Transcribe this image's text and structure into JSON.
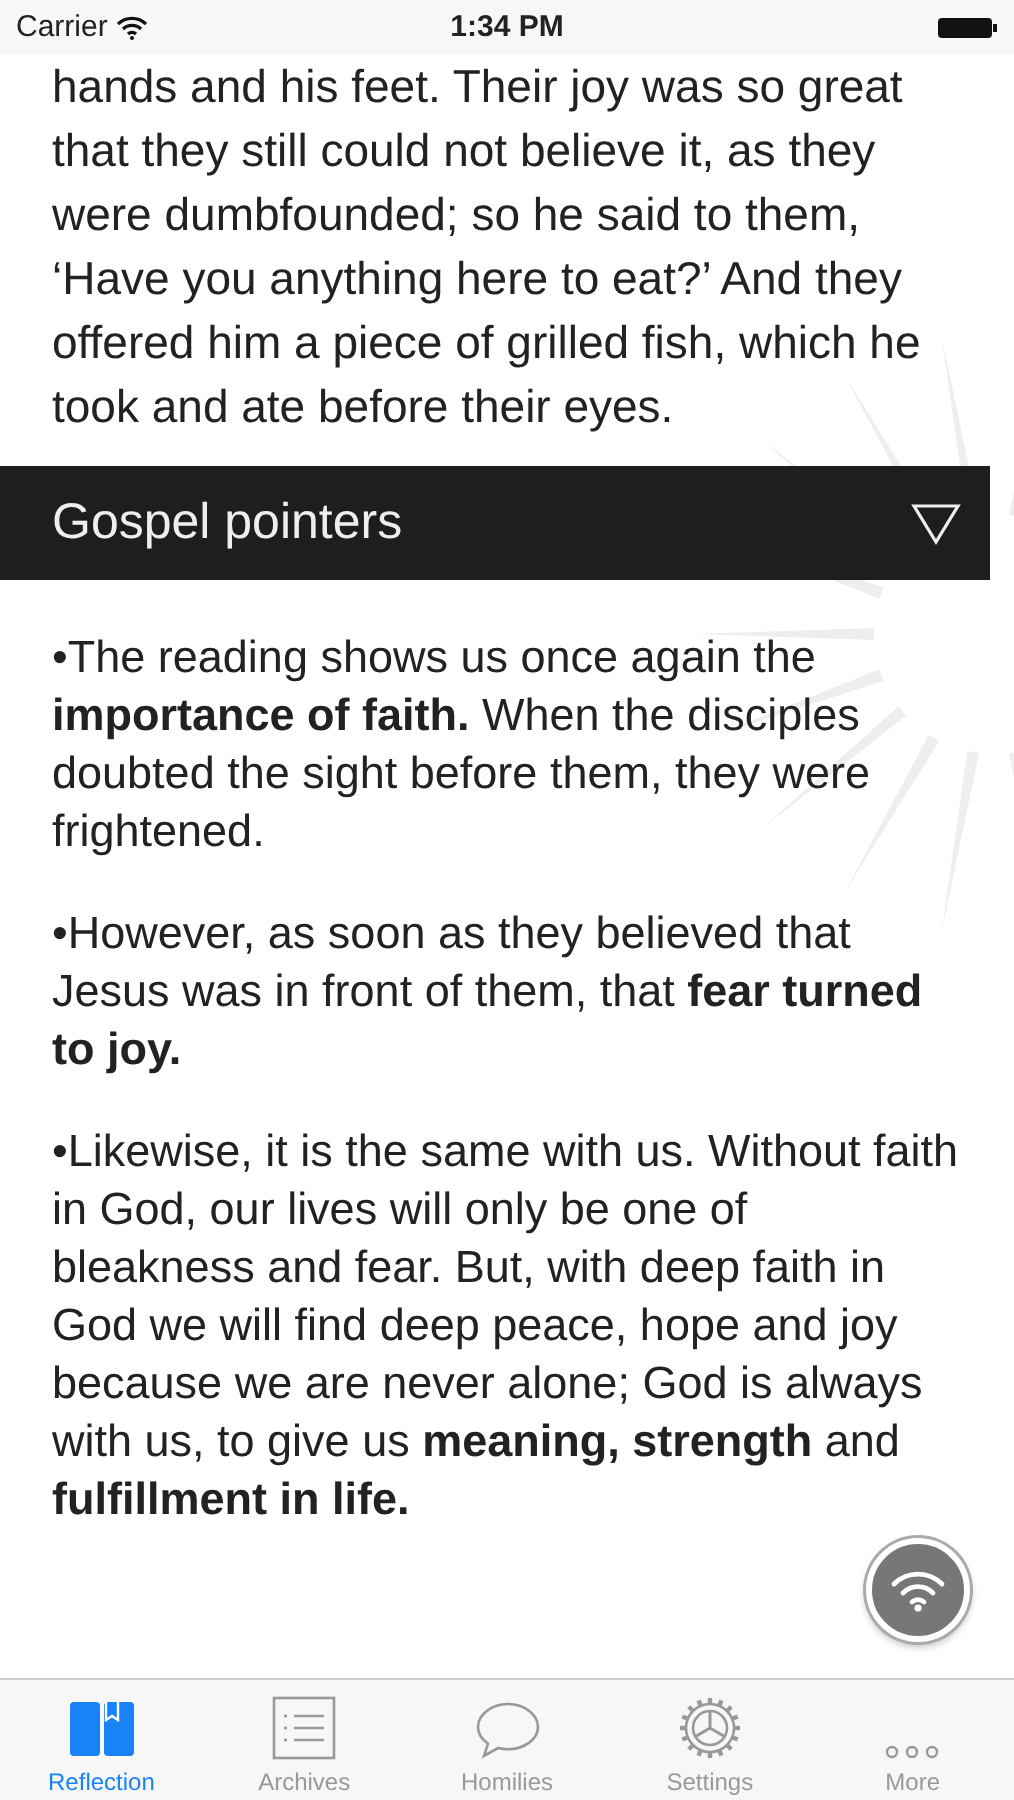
{
  "status_bar": {
    "carrier": "Carrier",
    "time": "1:34 PM"
  },
  "reading": {
    "lines": [
      "hands and his feet. Their joy was so great",
      "that they still could not believe it, as they",
      "were dumbfounded; so he said to them,",
      "‘Have you anything here to eat?’ And they",
      "offered him a piece of grilled fish, which he",
      "took and ate before their eyes."
    ]
  },
  "section": {
    "title": "Gospel pointers",
    "expanded": true
  },
  "pointers": [
    "•The reading shows us once again the **importance of faith.** When the disciples doubted the sight before them, they were frightened.",
    "•However, as soon as they believed that Jesus was in front of them, that **fear turned to joy.**",
    "•Likewise, it is the same with us. Without faith in God, our lives will only be one of bleakness and fear. But, with deep faith in God we will find deep peace, hope and joy because we are never alone; God is always with us, to give us **meaning, strength** and **fulfillment in life.**"
  ],
  "tab_bar": [
    {
      "label": "Reflection",
      "kind": "book",
      "selected": true
    },
    {
      "label": "Archives",
      "kind": "list",
      "selected": false
    },
    {
      "label": "Homilies",
      "kind": "bubble",
      "selected": false
    },
    {
      "label": "Settings",
      "kind": "gear",
      "selected": false
    },
    {
      "label": "More",
      "kind": "dots",
      "selected": false
    }
  ]
}
